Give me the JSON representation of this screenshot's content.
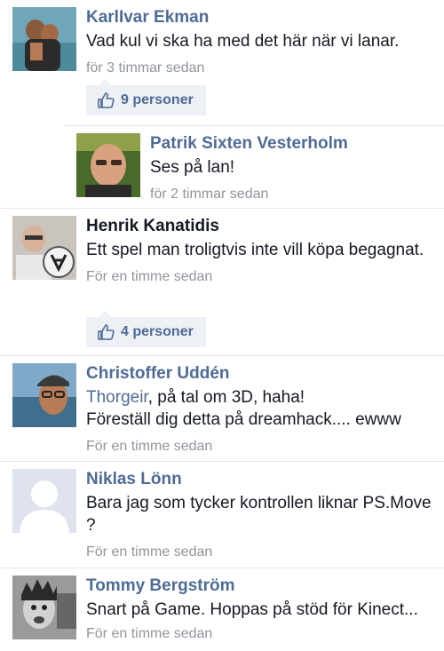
{
  "comments": [
    {
      "name": "KarlIvar Ekman",
      "text": "Vad kul vi ska ha med det här när vi lanar.",
      "time": "för 3 timmar sedan",
      "likes": "9 personer",
      "avatar": "photo-beach-couple"
    },
    {
      "name": "Patrik Sixten Vesterholm",
      "text": "Ses på lan!",
      "time": "för 2 timmar sedan",
      "avatar": "photo-man-bald"
    },
    {
      "name": "Henrik Kanatidis",
      "text": "Ett spel man troligtvis inte vill köpa begagnat.",
      "time": "För en timme sedan",
      "likes": "4 personer",
      "avatar": "photo-man-with-logo"
    },
    {
      "name": "Christoffer Uddén",
      "mention": "Thorgeir",
      "text_after_mention": ", på tal om 3D, haha!",
      "text_line2": "Föreställ dig detta på dreamhack.... ewww",
      "time": "För en timme sedan",
      "avatar": "photo-man-cap-glasses"
    },
    {
      "name": "Niklas Lönn",
      "text": "Bara jag som tycker kontrollen liknar PS.Move ?",
      "time": "För en timme sedan",
      "avatar": "default-silhouette"
    },
    {
      "name": "Tommy Bergström",
      "text": "Snart på Game. Hoppas på stöd för Kinect...",
      "time": "För en timme sedan",
      "avatar": "photo-man-face-bw"
    }
  ],
  "colors": {
    "link": "#4e6b96",
    "text": "#141823",
    "meta": "#90949c",
    "likes_bg": "#edf0f5"
  }
}
